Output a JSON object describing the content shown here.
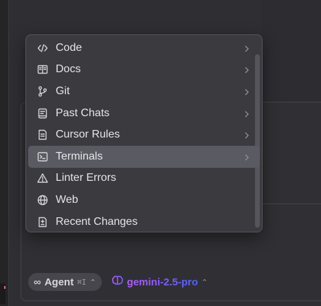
{
  "menu": {
    "items": [
      {
        "label": "Code",
        "icon": "code-icon",
        "has_submenu": true
      },
      {
        "label": "Docs",
        "icon": "book-icon",
        "has_submenu": true
      },
      {
        "label": "Git",
        "icon": "git-branch-icon",
        "has_submenu": true
      },
      {
        "label": "Past Chats",
        "icon": "chat-history-icon",
        "has_submenu": true
      },
      {
        "label": "Cursor Rules",
        "icon": "rules-file-icon",
        "has_submenu": true
      },
      {
        "label": "Terminals",
        "icon": "terminal-icon",
        "has_submenu": true,
        "selected": true
      },
      {
        "label": "Linter Errors",
        "icon": "warning-triangle-icon",
        "has_submenu": false
      },
      {
        "label": "Web",
        "icon": "globe-icon",
        "has_submenu": false
      },
      {
        "label": "Recent Changes",
        "icon": "diff-file-icon",
        "has_submenu": false
      }
    ]
  },
  "composer": {
    "agent_label": "Agent",
    "agent_shortcut": "⌘I",
    "model_label": "gemini-2.5-pro"
  },
  "colors": {
    "menu_background": "#3a3a3f",
    "selected_background": "#5a5a62",
    "model_gradient_start": "#b15cff",
    "model_gradient_end": "#4c62ff"
  }
}
